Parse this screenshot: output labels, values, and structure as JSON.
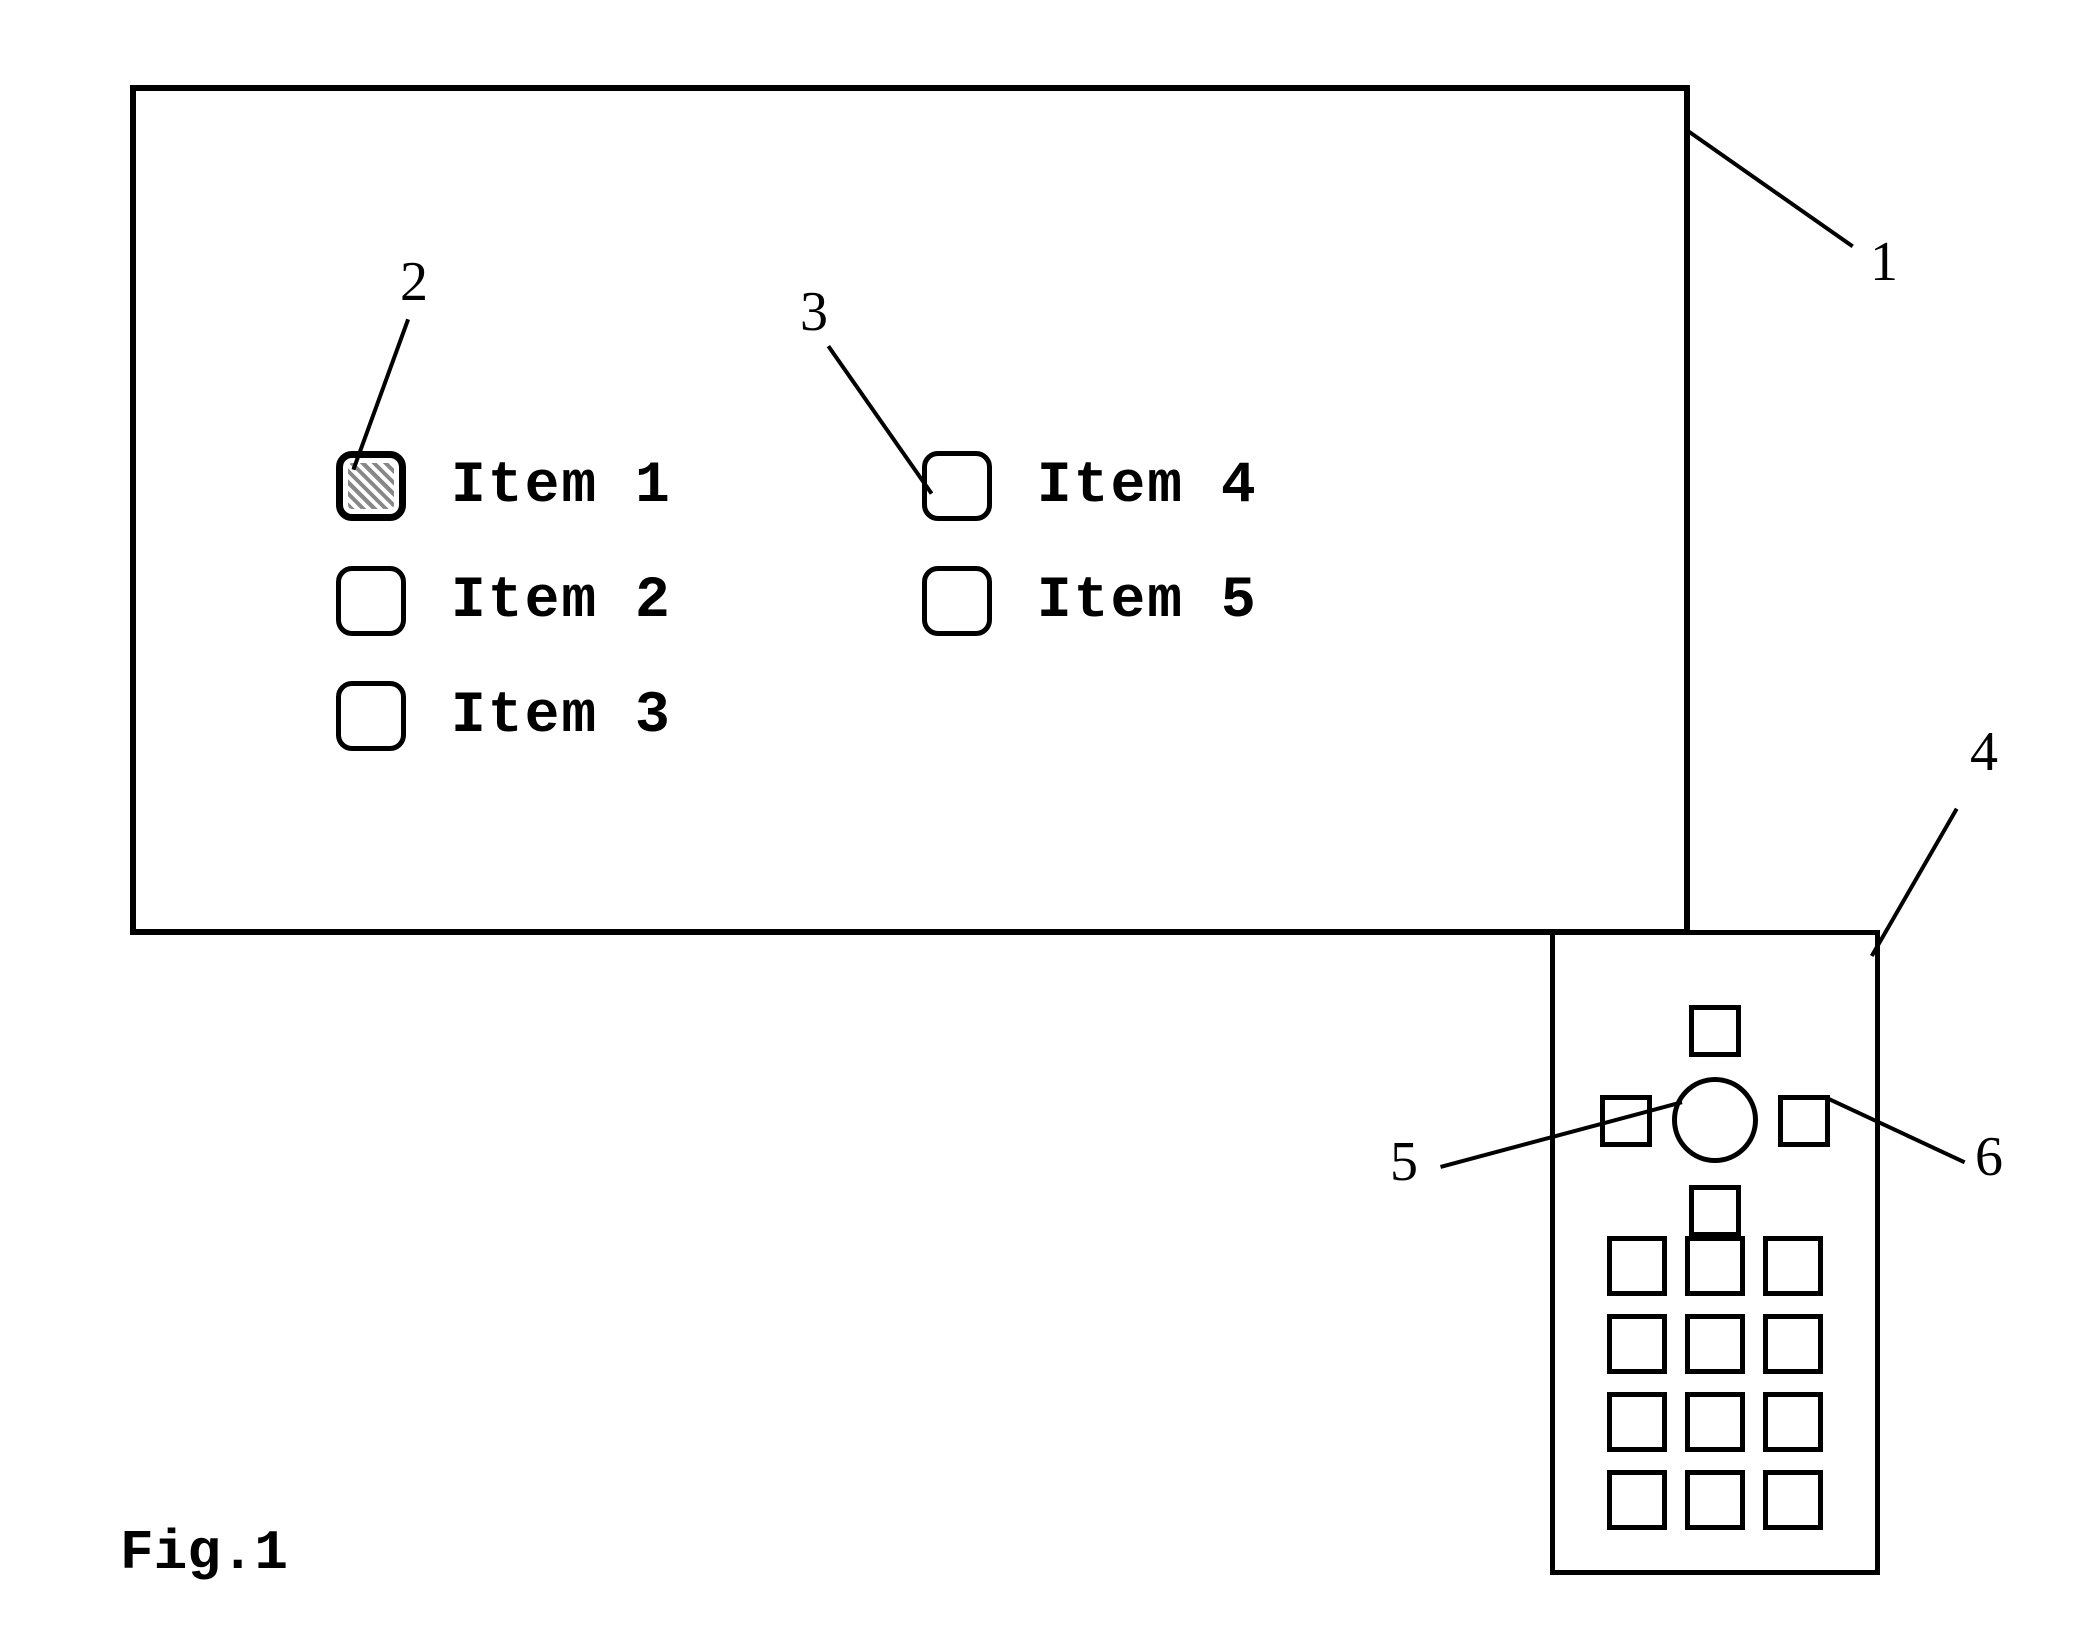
{
  "figure_label": "Fig.1",
  "callouts": {
    "screen": "1",
    "selected_checkbox": "2",
    "unselected_checkbox": "3",
    "remote": "4",
    "ok_button": "5",
    "dpad_right": "6"
  },
  "menu": {
    "col1": [
      {
        "label": "Item 1",
        "selected": true
      },
      {
        "label": "Item 2",
        "selected": false
      },
      {
        "label": "Item 3",
        "selected": false
      }
    ],
    "col2": [
      {
        "label": "Item 4",
        "selected": false
      },
      {
        "label": "Item 5",
        "selected": false
      }
    ]
  },
  "remote": {
    "dpad_buttons": 4,
    "grid_buttons": 12
  }
}
